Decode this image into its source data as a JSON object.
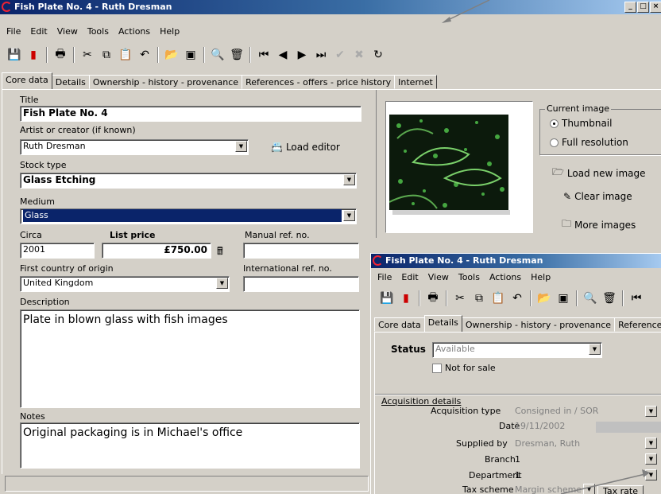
{
  "main_window": {
    "title": "Fish Plate No. 4 - Ruth Dresman",
    "controls": {
      "minimize": "_",
      "maximize": "□",
      "close": "×"
    },
    "menu": [
      "File",
      "Edit",
      "View",
      "Tools",
      "Actions",
      "Help"
    ],
    "tabs": [
      "Core data",
      "Details",
      "Ownership - history - provenance",
      "References - offers - price history",
      "Internet"
    ],
    "active_tab": "Core data",
    "form": {
      "title_label": "Title",
      "title_value": "Fish Plate No. 4",
      "artist_label": "Artist or creator (if known)",
      "artist_value": "Ruth Dresman",
      "load_editor_label": "Load editor",
      "stock_type_label": "Stock type",
      "stock_type_value": "Glass Etching",
      "medium_label": "Medium",
      "medium_value": "Glass",
      "circa_label": "Circa",
      "circa_value": "2001",
      "list_price_label": "List price",
      "list_price_value": "£750.00",
      "manual_ref_label": "Manual ref. no.",
      "manual_ref_value": "",
      "country_label": "First country of origin",
      "country_value": "United Kingdom",
      "intl_ref_label": "International ref. no.",
      "intl_ref_value": "",
      "description_label": "Description",
      "description_value": "Plate in blown glass with fish images",
      "notes_label": "Notes",
      "notes_value": "Original packaging is in Michael's office"
    },
    "image_panel": {
      "group_label": "Current image",
      "options": [
        "Thumbnail",
        "Full resolution"
      ],
      "selected_option": "Thumbnail",
      "load_new_label": "Load new image",
      "clear_label": "Clear image",
      "more_label": "More images"
    },
    "status_text": ""
  },
  "details_window": {
    "title": "Fish Plate No. 4 - Ruth Dresman",
    "menu": [
      "File",
      "Edit",
      "View",
      "Tools",
      "Actions",
      "Help"
    ],
    "tabs": [
      "Core data",
      "Details",
      "Ownership - history - provenance",
      "Reference"
    ],
    "active_tab": "Details",
    "status_label": "Status",
    "status_value": "Available",
    "not_for_sale_label": "Not for sale",
    "acq_section_label": "Acquisition details",
    "acq_type_label": "Acquisition type",
    "acq_type_value": "Consigned in / SOR",
    "date_label": "Date",
    "date_value": "19/11/2002",
    "supplied_by_label": "Supplied by",
    "supplied_by_value": "Dresman, Ruth",
    "branch_label": "Branch",
    "branch_value": "1",
    "department_label": "Department",
    "department_value": "1",
    "tax_scheme_label": "Tax scheme",
    "tax_scheme_value": "Margin scheme",
    "tax_rate_label": "Tax rate"
  },
  "colors": {
    "title_active": "#0a246a",
    "face": "#d4d0c8",
    "selection": "#0a246a"
  }
}
